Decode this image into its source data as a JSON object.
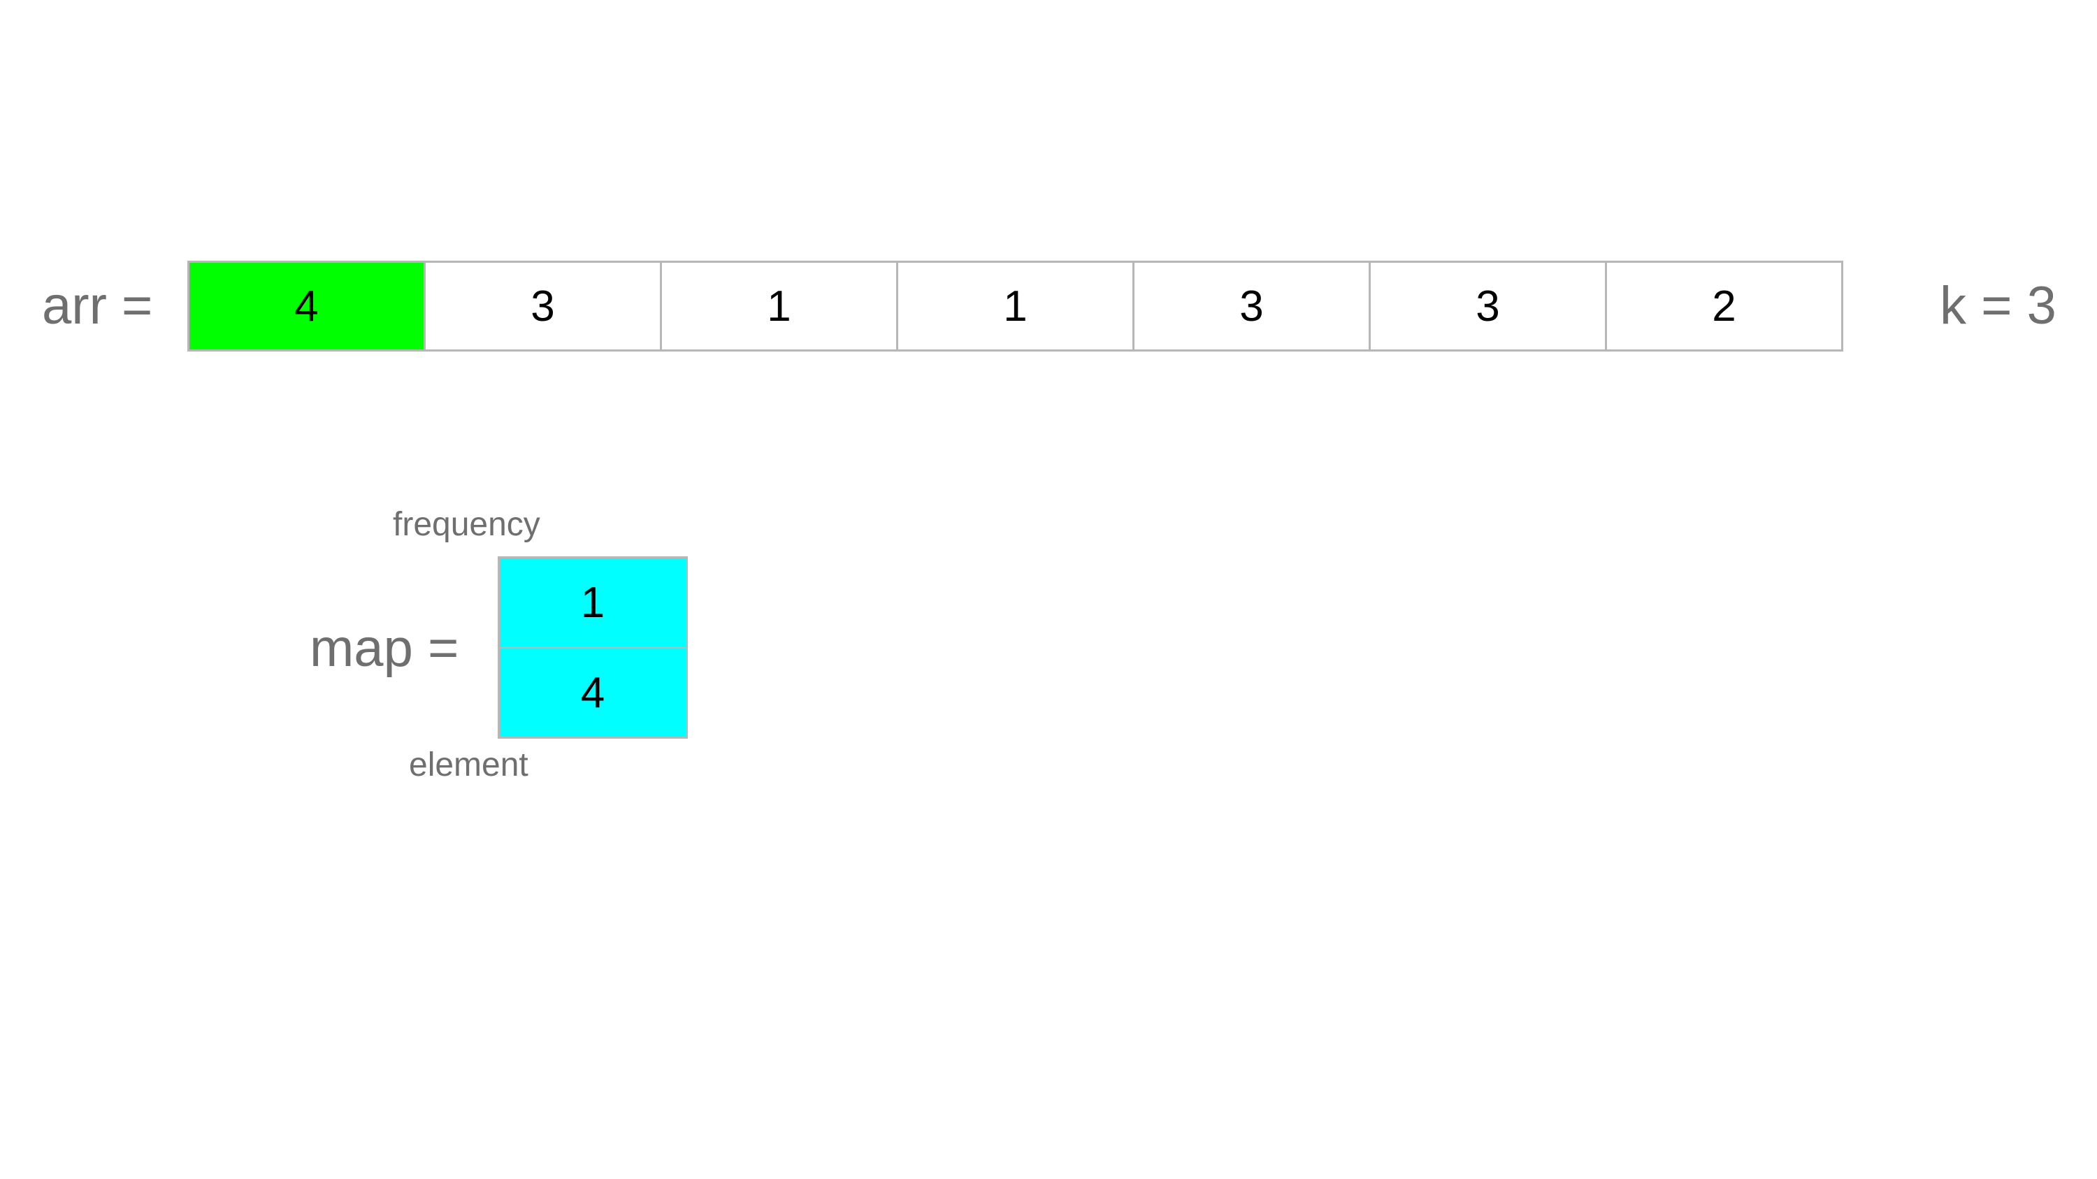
{
  "arr": {
    "label": "arr =",
    "cells": [
      {
        "value": "4",
        "color": "#00ff00"
      },
      {
        "value": "3",
        "color": "#ffffff"
      },
      {
        "value": "1",
        "color": "#ffffff"
      },
      {
        "value": "1",
        "color": "#ffffff"
      },
      {
        "value": "3",
        "color": "#ffffff"
      },
      {
        "value": "3",
        "color": "#ffffff"
      },
      {
        "value": "2",
        "color": "#ffffff"
      }
    ]
  },
  "k": {
    "label": "k = 3"
  },
  "map": {
    "label": "map =",
    "frequency_caption": "frequency",
    "element_caption": "element",
    "color": "#00ffff",
    "frequency": "1",
    "element": "4"
  }
}
